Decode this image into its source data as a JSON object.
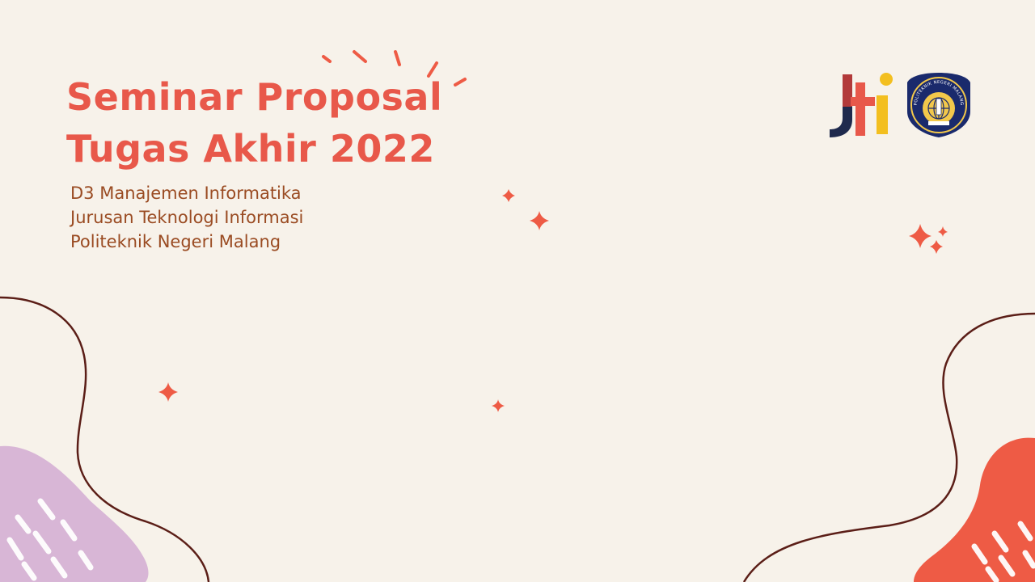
{
  "slide": {
    "title_line1": "Seminar Proposal",
    "title_line2": "Tugas Akhir 2022",
    "subtitle_line1": "D3 Manajemen Informatika",
    "subtitle_line2": "Jurusan Teknologi Informasi",
    "subtitle_line3": "Politeknik Negeri Malang"
  },
  "logos": {
    "polinema_ring_text": "POLITEKNIK NEGERI MALANG"
  },
  "colors": {
    "background": "#f7f2ea",
    "title": "#e8584a",
    "subtitle": "#9a4b22",
    "accent_red": "#ee5b45",
    "accent_lilac": "#d8b6d6",
    "curve_line": "#5b1e17"
  }
}
